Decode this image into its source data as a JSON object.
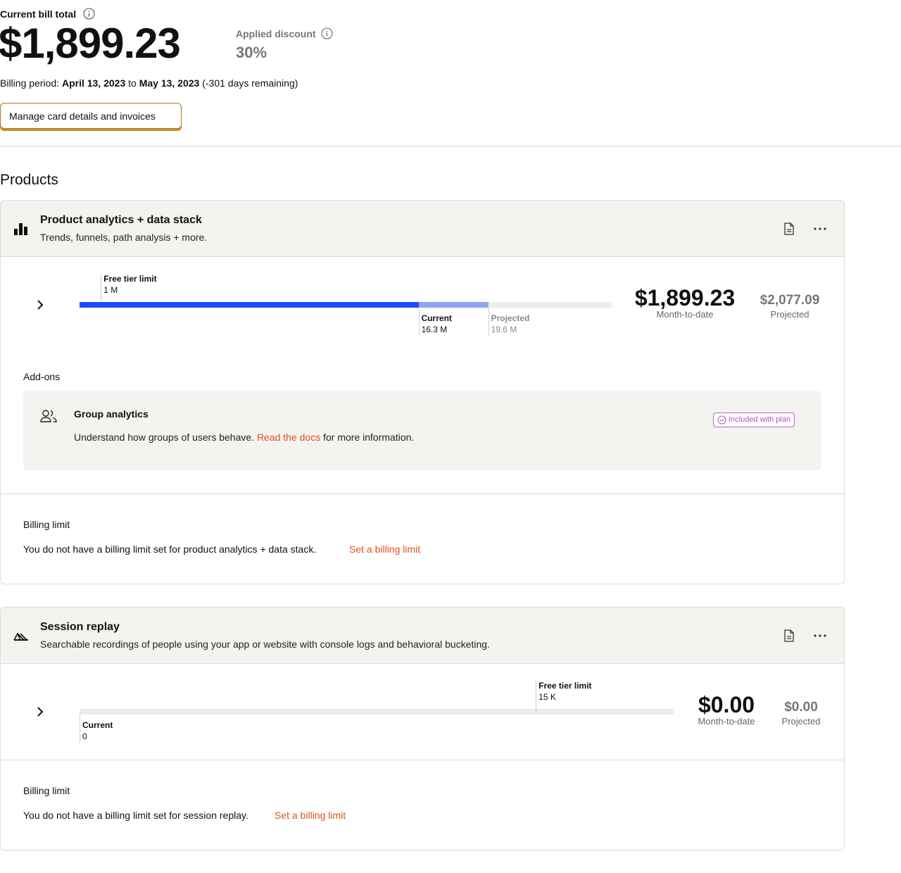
{
  "summary": {
    "current_label": "Current bill total",
    "current_amount": "$1,899.23",
    "discount_label": "Applied discount",
    "discount_value": "30%",
    "period_prefix": "Billing period:",
    "period_start": "April 13, 2023",
    "period_to": "to",
    "period_end": "May 13, 2023",
    "period_remaining": "(-301 days remaining)",
    "manage_button": "Manage card details and invoices"
  },
  "products_title": "Products",
  "products": [
    {
      "icon": "bar-chart-icon",
      "title": "Product analytics + data stack",
      "description": "Trends, funnels, path analysis + more.",
      "usage": {
        "free_tier_label": "Free tier limit",
        "free_tier_value": "1 M",
        "free_tier_fraction": 0.04,
        "current_label": "Current",
        "current_value": "16.3 M",
        "current_fraction": 0.637,
        "projected_label": "Projected",
        "projected_value": "19.6 M",
        "projected_fraction": 0.768
      },
      "mtd_amount": "$1,899.23",
      "mtd_label": "Month-to-date",
      "projected_amount": "$2,077.09",
      "projected_label": "Projected",
      "addons_title": "Add-ons",
      "addon": {
        "icon": "people-icon",
        "title": "Group analytics",
        "desc_pre": "Understand how groups of users behave.",
        "desc_link": "Read the docs",
        "desc_post": "for more information.",
        "badge": "Included with plan"
      },
      "billing_limit_title": "Billing limit",
      "billing_limit_text": "You do not have a billing limit set for product analytics + data stack.",
      "billing_limit_link": "Set a billing limit"
    },
    {
      "icon": "replay-icon",
      "title": "Session replay",
      "description": "Searchable recordings of people using your app or website with console logs and behavioral bucketing.",
      "usage": {
        "free_tier_label": "Free tier limit",
        "free_tier_value": "15 K",
        "free_tier_fraction": 0.768,
        "current_label": "Current",
        "current_value": "0",
        "current_fraction": 0
      },
      "mtd_amount": "$0.00",
      "mtd_label": "Month-to-date",
      "projected_amount": "$0.00",
      "projected_label": "Projected",
      "billing_limit_title": "Billing limit",
      "billing_limit_text": "You do not have a billing limit set for session replay.",
      "billing_limit_link": "Set a billing limit"
    }
  ],
  "colors": {
    "current_fill": "#1d4aff",
    "projected_fill": "#8fa2f2",
    "link": "#e0531c",
    "badge": "#b551c0",
    "button_accent": "#c78e1f"
  }
}
